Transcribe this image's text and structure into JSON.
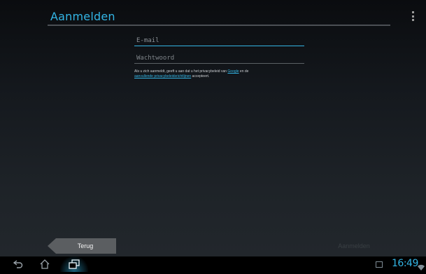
{
  "header": {
    "title": "Aanmelden"
  },
  "form": {
    "email_placeholder": "E-mail",
    "password_placeholder": "Wachtwoord",
    "privacy_prefix": "Als u zich aanmeldt, geeft u aan dat u het privacybeleid van ",
    "privacy_link_google": "Google",
    "privacy_middle": " en de ",
    "privacy_link_guidelines": "aanvullende privacybeleidsrichtlijnen",
    "privacy_suffix": " accepteert."
  },
  "footer": {
    "back_label": "Terug",
    "next_label": "Aanmelden"
  },
  "status_bar": {
    "time": "16:49"
  },
  "colors": {
    "accent": "#33b5e5",
    "background_top": "#0a0c0f",
    "background_bottom": "#23282d",
    "button_gray": "#5b5e61"
  },
  "icons": {
    "back": "back-arrow-icon",
    "home": "home-icon",
    "recent": "recent-apps-icon",
    "menu": "overflow-menu-icon",
    "gallery": "image-notification-icon",
    "wifi": "wifi-icon"
  }
}
